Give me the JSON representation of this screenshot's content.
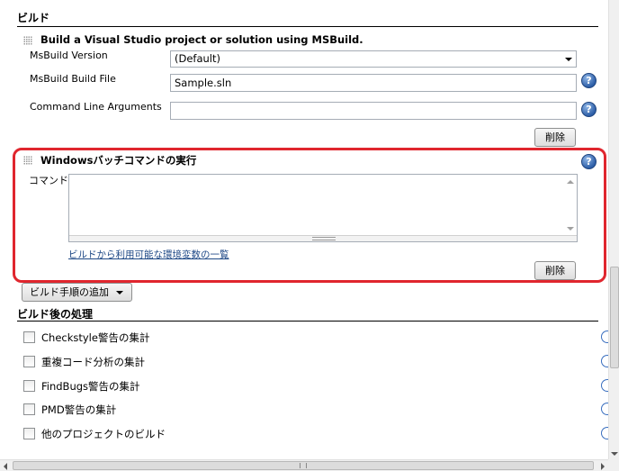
{
  "build": {
    "header": "ビルド",
    "msbuild_step": {
      "title": "Build a Visual Studio project or solution using MSBuild.",
      "version_label": "MsBuild Version",
      "version_value": "(Default)",
      "build_file_label": "MsBuild Build File",
      "build_file_value": "Sample.sln",
      "args_label": "Command Line Arguments",
      "args_value": "",
      "delete_label": "削除"
    },
    "batch_step": {
      "title": "Windowsバッチコマンドの実行",
      "command_label": "コマンド",
      "command_value": "",
      "env_link": "ビルドから利用可能な環境変数の一覧",
      "delete_label": "削除"
    },
    "add_step_label": "ビルド手順の追加"
  },
  "post_build": {
    "header": "ビルド後の処理",
    "items": [
      {
        "label": "Checkstyle警告の集計"
      },
      {
        "label": "重複コード分析の集計"
      },
      {
        "label": "FindBugs警告の集計"
      },
      {
        "label": "PMD警告の集計"
      },
      {
        "label": "他のプロジェクトのビルド"
      }
    ]
  },
  "icons": {
    "help": "help-icon",
    "dropdown": "chevron-down-icon",
    "drag": "drag-handle-icon"
  },
  "colors": {
    "highlight": "#e0262e",
    "help_icon": "#2e5fa8",
    "link": "#204a87"
  }
}
